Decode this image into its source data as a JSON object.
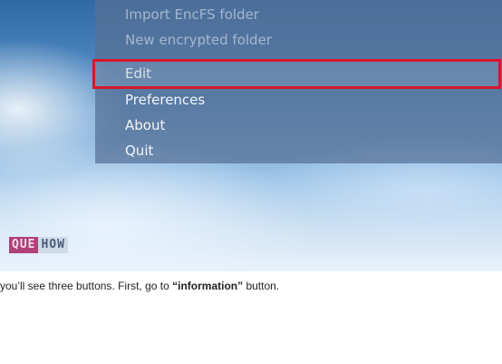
{
  "menu": {
    "items": [
      {
        "label": "Import EncFS folder"
      },
      {
        "label": "New encrypted folder"
      },
      {
        "label": "Edit"
      },
      {
        "label": "Preferences"
      },
      {
        "label": "About"
      },
      {
        "label": "Quit"
      }
    ],
    "highlighted_item": "Edit",
    "highlight_color": "#d3182a"
  },
  "logo": {
    "part1": "QUE",
    "part2": "HOW"
  },
  "caption": {
    "before": "you’ll see three buttons. First, go to ",
    "emphasis": "“information”",
    "after": " button."
  }
}
